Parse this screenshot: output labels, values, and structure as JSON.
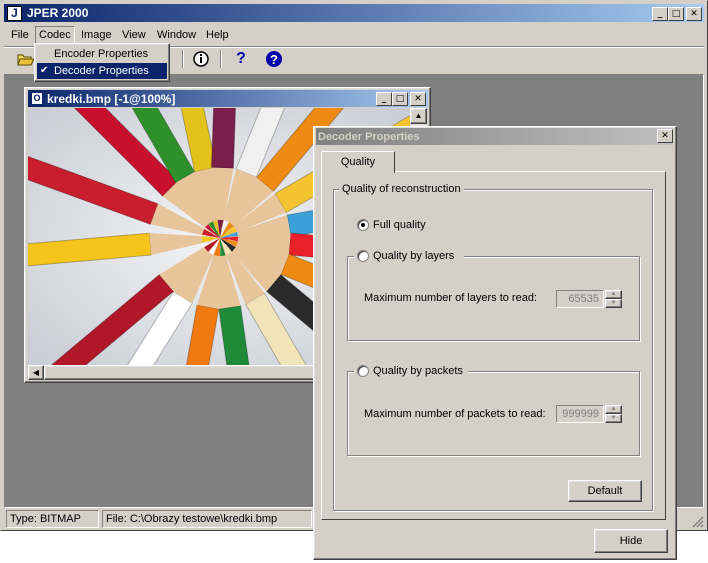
{
  "app": {
    "title": "JPER 2000",
    "icon_letter": "J",
    "menu": [
      "File",
      "Codec",
      "Image",
      "View",
      "Window",
      "Help"
    ],
    "codec_menu": {
      "items": [
        {
          "label": "Encoder Properties",
          "checked": false
        },
        {
          "label": "Decoder Properties",
          "checked": true,
          "check_glyph": "✔"
        }
      ]
    },
    "toolbar_icons": [
      "open-folder-icon",
      "info-icon",
      "help-question-icon",
      "about-question-icon"
    ],
    "status": {
      "type": "Type: BITMAP",
      "file": "File: C:\\Obrazy testowe\\kredki.bmp"
    }
  },
  "image_window": {
    "title": "kredki.bmp [-1@100%]",
    "zoom_percent": 100
  },
  "decoder_dialog": {
    "title": "Decoder Properties",
    "tab": "Quality",
    "group_title": "Quality of reconstruction",
    "options": {
      "full_quality": "Full quality",
      "by_layers": "Quality by layers",
      "by_packets": "Quality by packets"
    },
    "selected_option": "full_quality",
    "layers": {
      "label": "Maximum number of layers to read:",
      "value": "65535"
    },
    "packets": {
      "label": "Maximum number of packets to read:",
      "value": "999999"
    },
    "default_button": "Default",
    "hide_button": "Hide"
  },
  "colors": {
    "window_face": "#d4d0c8",
    "active_title": "#0a246a",
    "mdi_background": "#808080",
    "menu_highlight": "#0a246a"
  }
}
